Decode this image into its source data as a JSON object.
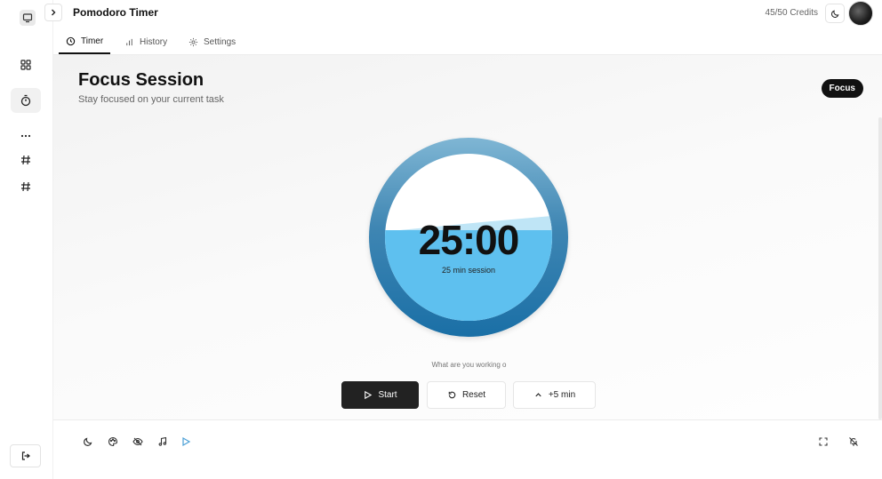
{
  "header": {
    "title": "Pomodoro Timer",
    "credits": "45/50 Credits"
  },
  "tabs": [
    {
      "label": "Timer",
      "icon": "clock-icon"
    },
    {
      "label": "History",
      "icon": "bar-chart-icon"
    },
    {
      "label": "Settings",
      "icon": "gear-icon"
    }
  ],
  "session": {
    "title": "Focus Session",
    "subtitle": "Stay focused on your current task",
    "mode_badge": "Focus",
    "time": "25:00",
    "length_label": "25 min session",
    "progress_fill": 0.5
  },
  "task": {
    "placeholder": "What are you working o"
  },
  "controls": {
    "start": "Start",
    "reset": "Reset",
    "add_time": "+5 min"
  },
  "colors": {
    "ring_dark": "#1a6fa6",
    "water": "#5ec0ef",
    "primary": "#222222"
  }
}
